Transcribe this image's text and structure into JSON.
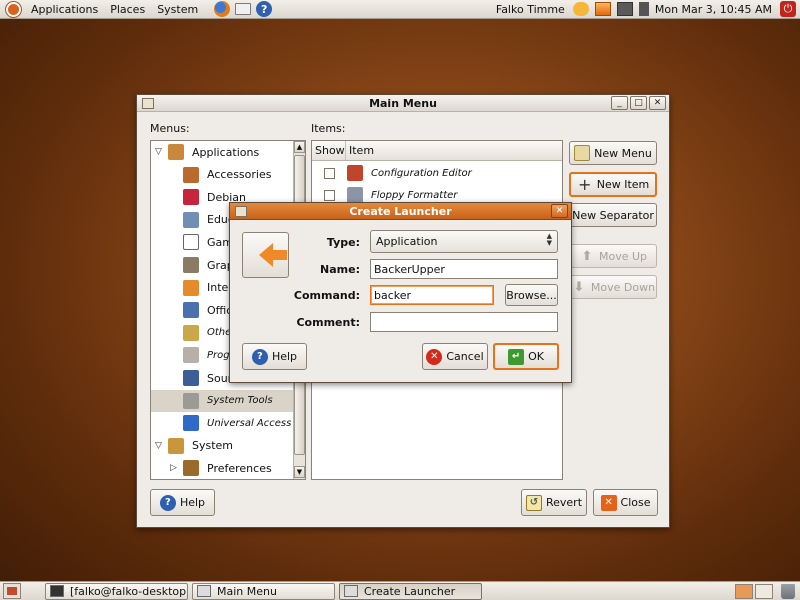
{
  "top_panel": {
    "menus": [
      "Applications",
      "Places",
      "System"
    ],
    "user": "Falko Timme",
    "clock": "Mon Mar  3, 10:45 AM",
    "icons": {
      "logo": "ubuntu-logo-icon",
      "firefox": "firefox-icon",
      "mail": "mail-icon",
      "help": "help-icon"
    }
  },
  "main_menu": {
    "title": "Main Menu",
    "menus_label": "Menus:",
    "items_label": "Items:",
    "tree": [
      {
        "label": "Applications",
        "level": 0,
        "expander": "down",
        "icon": "applications-icon"
      },
      {
        "label": "Accessories",
        "level": 1,
        "icon": "accessories-icon"
      },
      {
        "label": "Debian",
        "level": 1,
        "icon": "debian-icon"
      },
      {
        "label": "Educ",
        "level": 1,
        "icon": "education-icon"
      },
      {
        "label": "Gam",
        "level": 1,
        "icon": "games-icon"
      },
      {
        "label": "Grap",
        "level": 1,
        "icon": "graphics-icon"
      },
      {
        "label": "Inter",
        "level": 1,
        "icon": "internet-icon"
      },
      {
        "label": "Offic",
        "level": 1,
        "icon": "office-icon"
      },
      {
        "label": "Other",
        "level": 1,
        "italic": true,
        "icon": "other-icon"
      },
      {
        "label": "Progr",
        "level": 1,
        "italic": true,
        "icon": "programming-icon"
      },
      {
        "label": "Sour",
        "level": 1,
        "icon": "sound-icon"
      },
      {
        "label": "System Tools",
        "level": 1,
        "italic": true,
        "selected": true,
        "icon": "system-tools-icon"
      },
      {
        "label": "Universal Access",
        "level": 1,
        "italic": true,
        "icon": "universal-access-icon"
      },
      {
        "label": "System",
        "level": 0,
        "expander": "down",
        "icon": "system-icon"
      },
      {
        "label": "Preferences",
        "level": 1,
        "expander": "right",
        "icon": "preferences-icon"
      }
    ],
    "items_columns": [
      "Show",
      "Item"
    ],
    "items": [
      {
        "label": "Configuration Editor",
        "icon": "config-editor-icon"
      },
      {
        "label": "Floppy Formatter",
        "icon": "floppy-icon"
      }
    ],
    "buttons": {
      "new_menu": "New Menu",
      "new_item": "New Item",
      "new_separator": "New Separator",
      "move_up": "Move Up",
      "move_down": "Move Down",
      "help": "Help",
      "revert": "Revert",
      "close": "Close"
    }
  },
  "create_launcher": {
    "title": "Create Launcher",
    "type_label": "Type:",
    "type_value": "Application",
    "name_label": "Name:",
    "name_value": "BackerUpper",
    "command_label": "Command:",
    "command_value": "backer",
    "comment_label": "Comment:",
    "comment_value": "",
    "browse": "Browse...",
    "help": "Help",
    "cancel": "Cancel",
    "ok": "OK"
  },
  "taskbar": {
    "tasks": [
      {
        "label": "[falko@falko-desktop:...",
        "icon": "terminal-icon"
      },
      {
        "label": "Main Menu",
        "icon": "main-menu-icon"
      },
      {
        "label": "Create Launcher",
        "icon": "create-launcher-icon"
      }
    ]
  },
  "colors": {
    "accent": "#e6721b",
    "desktop": "#8a4718",
    "panel": "#dcd7ce"
  }
}
